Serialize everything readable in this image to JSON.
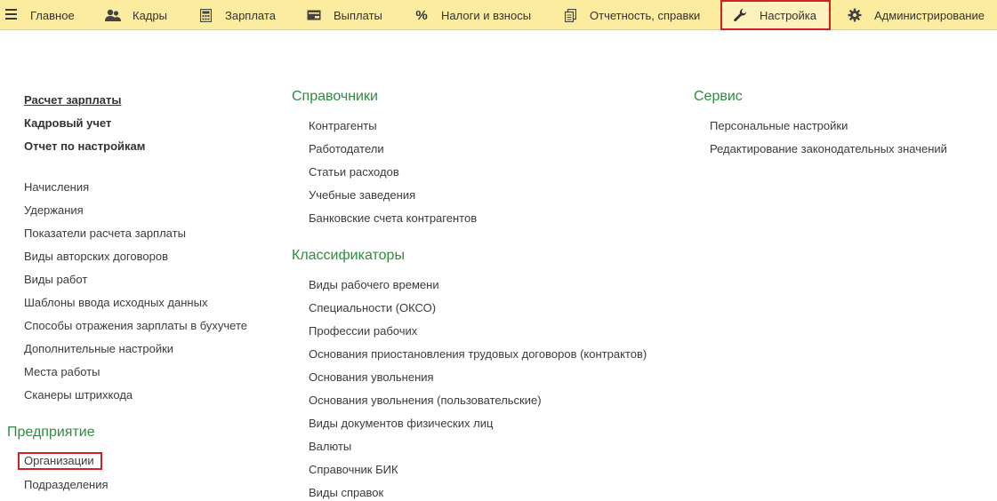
{
  "nav": {
    "items": [
      {
        "label": "Главное",
        "icon": "menu-icon"
      },
      {
        "label": "Кадры",
        "icon": "people-icon"
      },
      {
        "label": "Зарплата",
        "icon": "calculator-icon"
      },
      {
        "label": "Выплаты",
        "icon": "wallet-icon"
      },
      {
        "label": "Налоги и взносы",
        "icon": "percent-icon"
      },
      {
        "label": "Отчетность, справки",
        "icon": "documents-icon"
      },
      {
        "label": "Настройка",
        "icon": "wrench-icon",
        "active": true
      },
      {
        "label": "Администрирование",
        "icon": "gear-icon"
      }
    ]
  },
  "col1": {
    "bold_links": [
      "Расчет зарплаты",
      "Кадровый учет",
      "Отчет по настройкам"
    ],
    "links": [
      "Начисления",
      "Удержания",
      "Показатели расчета зарплаты",
      "Виды авторских договоров",
      "Виды работ",
      "Шаблоны ввода исходных данных",
      "Способы отражения зарплаты в бухучете",
      "Дополнительные настройки",
      "Места работы",
      "Сканеры штрихкода"
    ],
    "enterprise": {
      "title": "Предприятие",
      "links": [
        "Организации",
        "Подразделения"
      ]
    }
  },
  "col2": {
    "directories": {
      "title": "Справочники",
      "links": [
        "Контрагенты",
        "Работодатели",
        "Статьи расходов",
        "Учебные заведения",
        "Банковские счета контрагентов"
      ]
    },
    "classifiers": {
      "title": "Классификаторы",
      "links": [
        "Виды рабочего времени",
        "Специальности (ОКСО)",
        "Профессии рабочих",
        "Основания приостановления трудовых договоров (контрактов)",
        "Основания увольнения",
        "Основания увольнения (пользовательские)",
        "Виды документов физических лиц",
        "Валюты",
        "Справочник БИК",
        "Виды справок"
      ]
    }
  },
  "col3": {
    "service": {
      "title": "Сервис",
      "links": [
        "Персональные настройки",
        "Редактирование законодательных значений"
      ]
    }
  },
  "colors": {
    "topbar": "#fbec9f",
    "section_title": "#2e8b3f",
    "highlight": "#d1202a"
  }
}
